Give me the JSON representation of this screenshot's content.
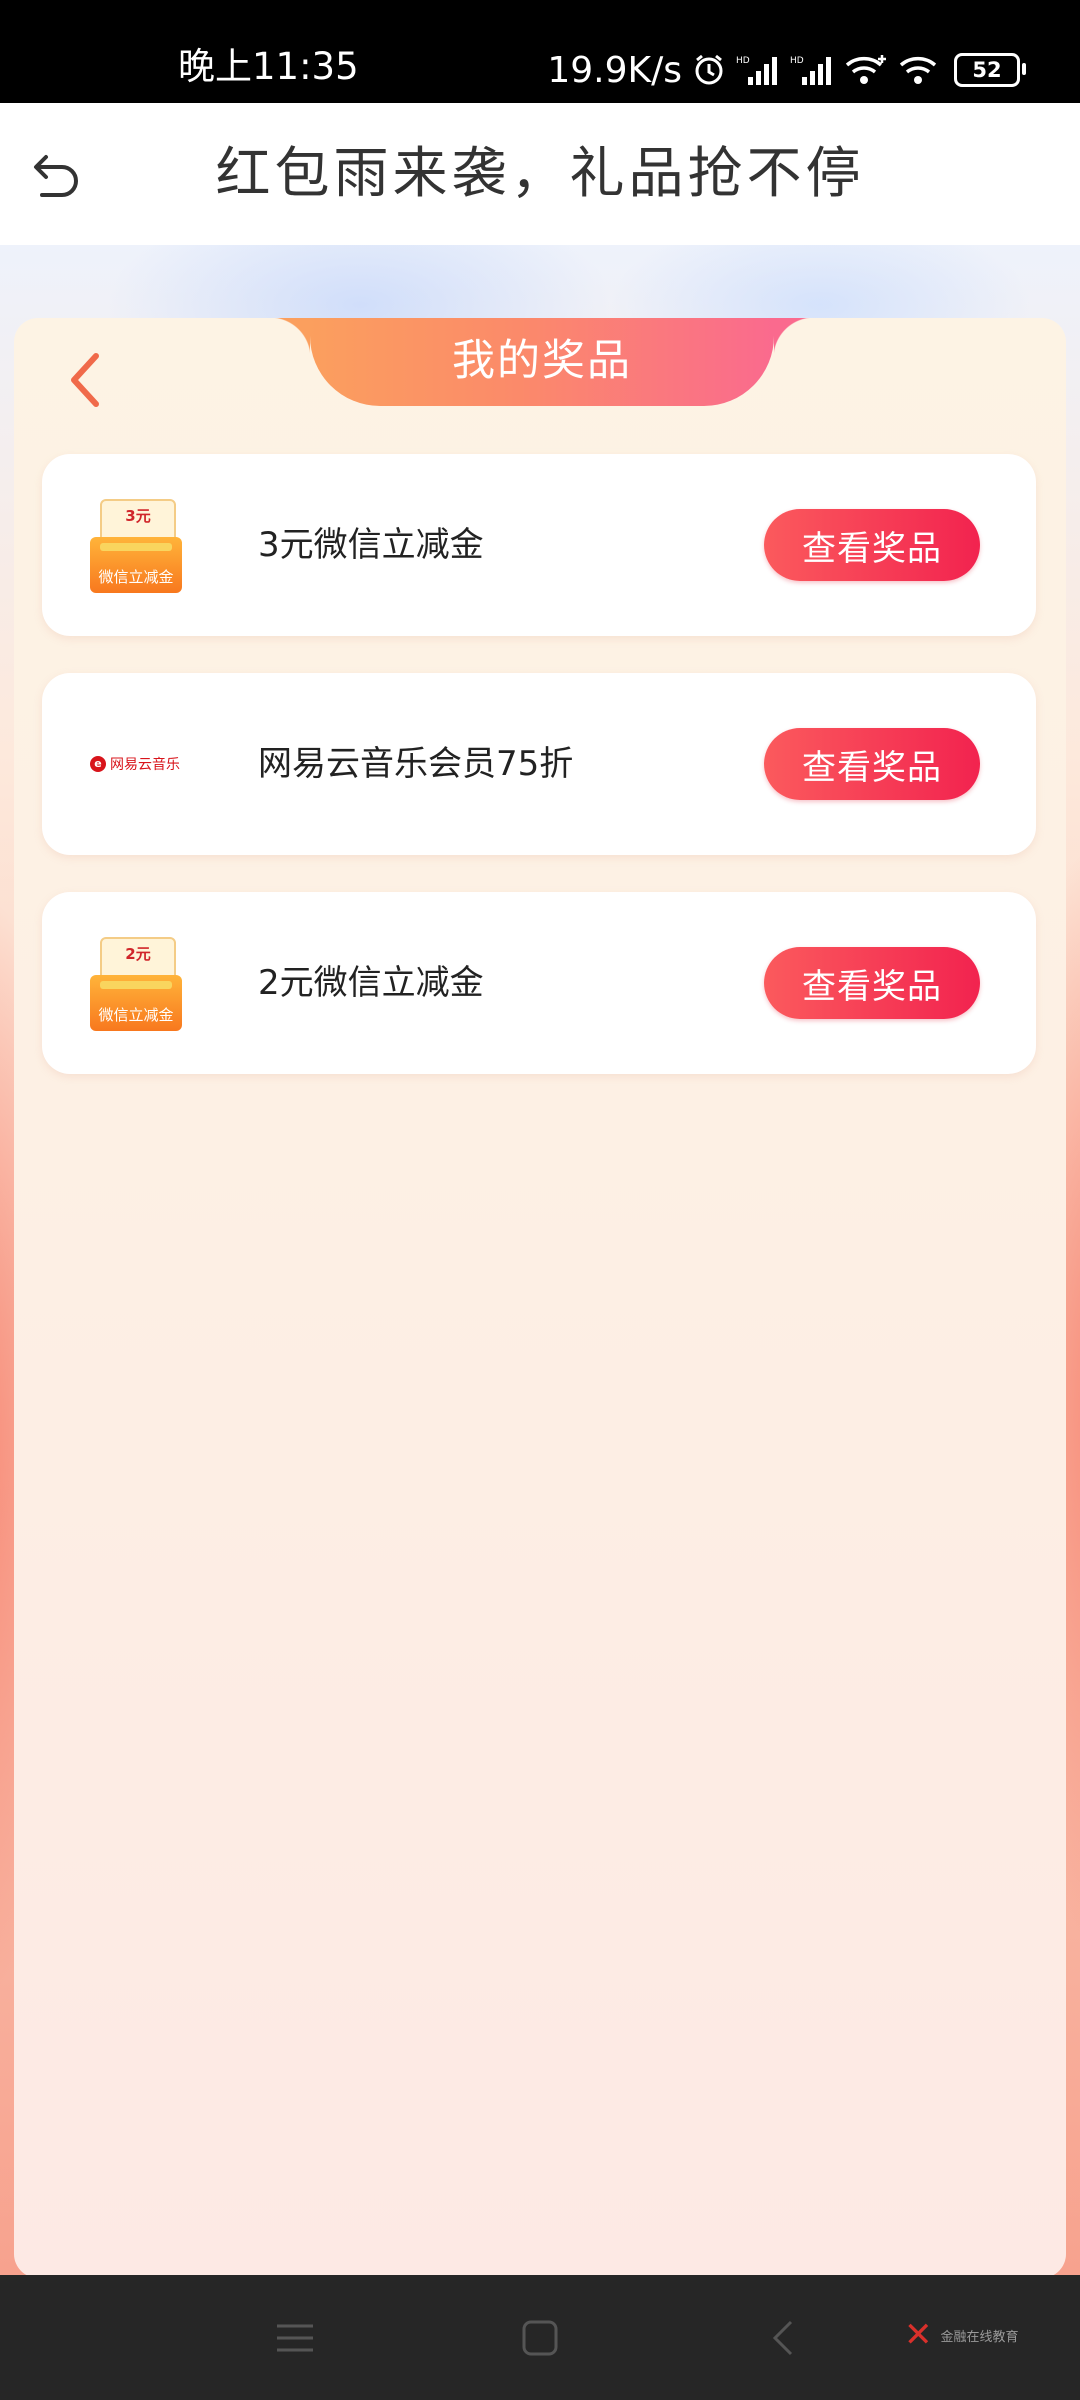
{
  "status_bar": {
    "time": "晚上11:35",
    "network_speed": "19.9K/s",
    "icons": [
      "alarm-icon",
      "hd-signal-icon",
      "hd-signal-icon",
      "wifi-plus-icon",
      "wifi-icon"
    ],
    "battery": "52"
  },
  "title_bar": {
    "back_icon": "undo-arrow-icon",
    "title": "红包雨来袭，礼品抢不停"
  },
  "panel": {
    "back_icon": "chevron-left-icon",
    "tab_title": "我的奖品",
    "prizes": [
      {
        "icon": "wechat-coupon-icon",
        "coupon_amount": "3元",
        "coupon_label": "微信立减金",
        "name": "3元微信立减金",
        "button": "查看奖品"
      },
      {
        "icon": "netease-music-logo",
        "logo_text": "网易云音乐",
        "name": "网易云音乐会员75折",
        "button": "查看奖品"
      },
      {
        "icon": "wechat-coupon-icon",
        "coupon_amount": "2元",
        "coupon_label": "微信立减金",
        "name": "2元微信立减金",
        "button": "查看奖品"
      }
    ]
  },
  "nav_bar": {
    "buttons": [
      "menu-icon",
      "home-icon",
      "back-icon"
    ],
    "brand_text": "金融在线教育"
  },
  "colors": {
    "accent": "#f2234f",
    "tab_gradient_start": "#fb9f5e",
    "tab_gradient_end": "#fa6a8e"
  }
}
